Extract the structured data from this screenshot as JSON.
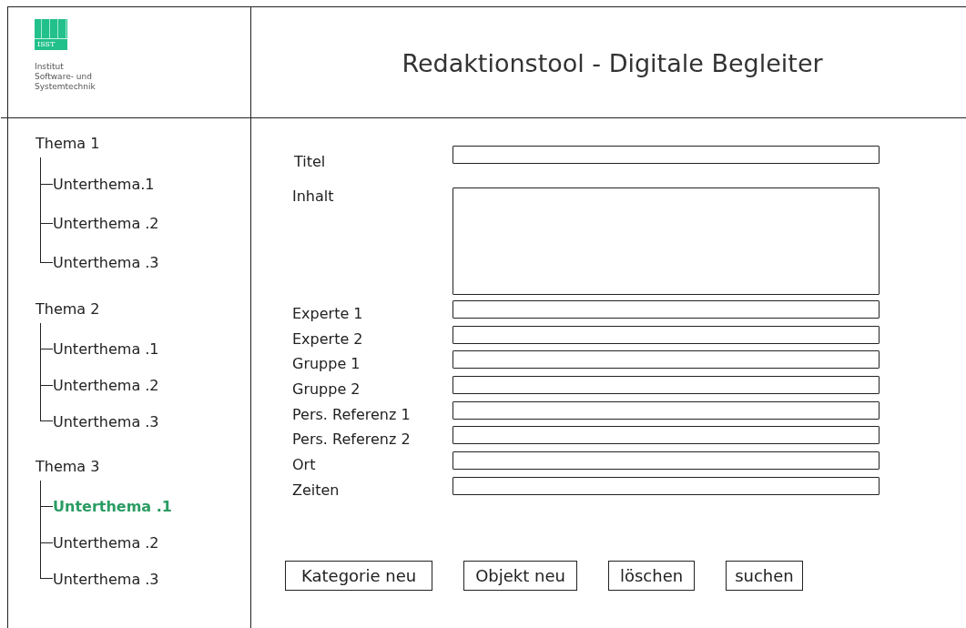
{
  "logo": {
    "mark": "ISST",
    "text": [
      "Institut",
      "Software- und",
      "Systemtechnik"
    ]
  },
  "header": {
    "title": "Redaktionstool - Digitale Begleiter"
  },
  "tree": [
    {
      "label": "Thema 1",
      "children": [
        {
          "label": "Unterthema.1",
          "selected": false
        },
        {
          "label": "Unterthema .2",
          "selected": false
        },
        {
          "label": "Unterthema .3",
          "selected": false
        }
      ]
    },
    {
      "label": "Thema 2",
      "children": [
        {
          "label": "Unterthema .1",
          "selected": false
        },
        {
          "label": "Unterthema .2",
          "selected": false
        },
        {
          "label": "Unterthema .3",
          "selected": false
        }
      ]
    },
    {
      "label": "Thema 3",
      "children": [
        {
          "label": "Unterthema .1",
          "selected": true
        },
        {
          "label": "Unterthema .2",
          "selected": false
        },
        {
          "label": "Unterthema .3",
          "selected": false
        }
      ]
    }
  ],
  "form": [
    {
      "label": "Titel",
      "kind": "line"
    },
    {
      "label": "Inhalt",
      "kind": "area"
    },
    {
      "label": "Experte 1",
      "kind": "line"
    },
    {
      "label": "Experte 2",
      "kind": "line"
    },
    {
      "label": "Gruppe 1",
      "kind": "line"
    },
    {
      "label": "Gruppe 2",
      "kind": "line"
    },
    {
      "label": "Pers. Referenz 1",
      "kind": "line"
    },
    {
      "label": "Pers. Referenz 2",
      "kind": "line"
    },
    {
      "label": "Ort",
      "kind": "line"
    },
    {
      "label": "Zeiten",
      "kind": "line"
    }
  ],
  "buttons": [
    "Kategorie neu",
    "Objekt neu",
    "löschen",
    "suchen"
  ]
}
